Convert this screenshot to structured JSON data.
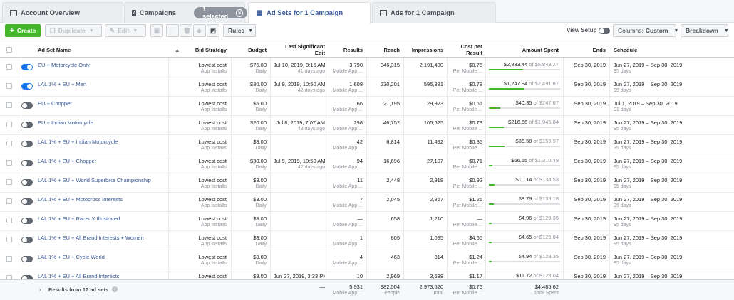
{
  "tabs": {
    "account": "Account Overview",
    "campaigns": "Campaigns",
    "selected": "1 selected",
    "adsets": "Ad Sets for 1 Campaign",
    "ads": "Ads for 1 Campaign"
  },
  "toolbar": {
    "create": "Create",
    "duplicate": "Duplicate",
    "edit": "Edit",
    "rules": "Rules",
    "view_setup": "View Setup",
    "columns_label": "Columns:",
    "columns_value": "Custom",
    "breakdown": "Breakdown"
  },
  "headers": {
    "name": "Ad Set Name",
    "bid": "Bid Strategy",
    "budget": "Budget",
    "last_edit": "Last Significant Edit",
    "results": "Results",
    "reach": "Reach",
    "impressions": "Impressions",
    "cpr": "Cost per Result",
    "spent": "Amount Spent",
    "ends": "Ends",
    "schedule": "Schedule"
  },
  "rows": [
    {
      "on": true,
      "name": "EU + Motorcycle Only",
      "bid": "Lowest cost",
      "bid_sub": "App Installs",
      "budget": "$75.00",
      "budget_sub": "Daily",
      "edit": "Jul 10, 2019, 8:15 AM",
      "edit_sub": "41 days ago",
      "results": "3,790",
      "results_sub": "Mobile App ...",
      "reach": "846,315",
      "impr": "2,191,400",
      "cpr": "$0.75",
      "cpr_sub": "Per Mobile ...",
      "spent": "$2,833.44",
      "of": "of $5,843.27",
      "pct": 0.48,
      "ends": "Sep 30, 2019",
      "sched": "Jun 27, 2019 – Sep 30, 2019",
      "days": "95 days"
    },
    {
      "on": true,
      "name": "LAL 1% + EU + Men",
      "bid": "Lowest cost",
      "bid_sub": "App Installs",
      "budget": "$30.00",
      "budget_sub": "Daily",
      "edit": "Jul 9, 2019, 10:50 AM",
      "edit_sub": "42 days ago",
      "results": "1,608",
      "results_sub": "Mobile App ...",
      "reach": "230,201",
      "impr": "595,381",
      "cpr": "$0.78",
      "cpr_sub": "Per Mobile ...",
      "spent": "$1,247.94",
      "of": "of $2,491.87",
      "pct": 0.5,
      "ends": "Sep 30, 2019",
      "sched": "Jun 27, 2019 – Sep 30, 2019",
      "days": "95 days"
    },
    {
      "on": false,
      "name": "EU + Chopper",
      "bid": "Lowest cost",
      "bid_sub": "App Installs",
      "budget": "$5.00",
      "budget_sub": "Daily",
      "edit": "",
      "edit_sub": "",
      "results": "66",
      "results_sub": "Mobile App ...",
      "reach": "21,195",
      "impr": "29,923",
      "cpr": "$0.61",
      "cpr_sub": "Per Mobile ...",
      "spent": "$40.35",
      "of": "of $247.67",
      "pct": 0.16,
      "ends": "Sep 30, 2019",
      "sched": "Jul 1, 2019 – Sep 30, 2019",
      "days": "91 days"
    },
    {
      "on": false,
      "name": "EU + Indian Motorcycle",
      "bid": "Lowest cost",
      "bid_sub": "App Installs",
      "budget": "$20.00",
      "budget_sub": "Daily",
      "edit": "Jul 8, 2019, 7:07 AM",
      "edit_sub": "43 days ago",
      "results": "298",
      "results_sub": "Mobile App ...",
      "reach": "46,752",
      "impr": "105,625",
      "cpr": "$0.73",
      "cpr_sub": "Per Mobile ...",
      "spent": "$216.56",
      "of": "of $1,045.84",
      "pct": 0.21,
      "ends": "Sep 30, 2019",
      "sched": "Jun 27, 2019 – Sep 30, 2019",
      "days": "95 days"
    },
    {
      "on": false,
      "name": "LAL 1% + EU + Indian Motorcycle",
      "bid": "Lowest cost",
      "bid_sub": "App Installs",
      "budget": "$3.00",
      "budget_sub": "Daily",
      "edit": "",
      "edit_sub": "",
      "results": "42",
      "results_sub": "Mobile App ...",
      "reach": "6,814",
      "impr": "11,492",
      "cpr": "$0.85",
      "cpr_sub": "Per Mobile ...",
      "spent": "$35.58",
      "of": "of $159.97",
      "pct": 0.22,
      "ends": "Sep 30, 2019",
      "sched": "Jun 27, 2019 – Sep 30, 2019",
      "days": "95 days"
    },
    {
      "on": false,
      "name": "LAL 1% + EU + Chopper",
      "bid": "Lowest cost",
      "bid_sub": "App Installs",
      "budget": "$30.00",
      "budget_sub": "Daily",
      "edit": "Jul 9, 2019, 10:50 AM",
      "edit_sub": "42 days ago",
      "results": "94",
      "results_sub": "Mobile App ...",
      "reach": "16,696",
      "impr": "27,107",
      "cpr": "$0.71",
      "cpr_sub": "Per Mobile ...",
      "spent": "$66.55",
      "of": "of $1,310.48",
      "pct": 0.05,
      "ends": "Sep 30, 2019",
      "sched": "Jun 27, 2019 – Sep 30, 2019",
      "days": "95 days"
    },
    {
      "on": false,
      "name": "LAL 1% + EU + World Superbike Championship",
      "bid": "Lowest cost",
      "bid_sub": "App Installs",
      "budget": "$3.00",
      "budget_sub": "Daily",
      "edit": "",
      "edit_sub": "",
      "results": "11",
      "results_sub": "Mobile App ...",
      "reach": "2,448",
      "impr": "2,918",
      "cpr": "$0.92",
      "cpr_sub": "Per Mobile ...",
      "spent": "$10.14",
      "of": "of $134.53",
      "pct": 0.08,
      "ends": "Sep 30, 2019",
      "sched": "Jun 27, 2019 – Sep 30, 2019",
      "days": "95 days"
    },
    {
      "on": false,
      "name": "LAL 1% + EU + Motocross Interests",
      "bid": "Lowest cost",
      "bid_sub": "App Installs",
      "budget": "$3.00",
      "budget_sub": "Daily",
      "edit": "",
      "edit_sub": "",
      "results": "7",
      "results_sub": "Mobile App ...",
      "reach": "2,045",
      "impr": "2,867",
      "cpr": "$1.26",
      "cpr_sub": "Per Mobile ...",
      "spent": "$8.79",
      "of": "of $133.18",
      "pct": 0.07,
      "ends": "Sep 30, 2019",
      "sched": "Jun 27, 2019 – Sep 30, 2019",
      "days": "95 days"
    },
    {
      "on": false,
      "name": "LAL 1% + EU + Racer X Illustrated",
      "bid": "Lowest cost",
      "bid_sub": "App Installs",
      "budget": "$3.00",
      "budget_sub": "Daily",
      "edit": "",
      "edit_sub": "",
      "results": "—",
      "results_sub": "Mobile App ...",
      "reach": "658",
      "impr": "1,210",
      "cpr": "—",
      "cpr_sub": "Per Mobile ...",
      "spent": "$4.96",
      "of": "of $129.35",
      "pct": 0.04,
      "ends": "Sep 30, 2019",
      "sched": "Jun 27, 2019 – Sep 30, 2019",
      "days": "95 days"
    },
    {
      "on": false,
      "name": "LAL 1% + EU + All Brand Interests + Women",
      "bid": "Lowest cost",
      "bid_sub": "App Installs",
      "budget": "$3.00",
      "budget_sub": "Daily",
      "edit": "",
      "edit_sub": "",
      "results": "1",
      "results_sub": "Mobile App ...",
      "reach": "805",
      "impr": "1,095",
      "cpr": "$4.65",
      "cpr_sub": "Per Mobile ...",
      "spent": "$4.65",
      "of": "of $129.04",
      "pct": 0.04,
      "ends": "Sep 30, 2019",
      "sched": "Jun 27, 2019 – Sep 30, 2019",
      "days": "95 days"
    },
    {
      "on": false,
      "name": "LAL 1% + EU + Cycle World",
      "bid": "Lowest cost",
      "bid_sub": "App Installs",
      "budget": "$3.00",
      "budget_sub": "Daily",
      "edit": "",
      "edit_sub": "",
      "results": "4",
      "results_sub": "Mobile App ...",
      "reach": "463",
      "impr": "814",
      "cpr": "$1.24",
      "cpr_sub": "Per Mobile ...",
      "spent": "$4.94",
      "of": "of $129.35",
      "pct": 0.04,
      "ends": "Sep 30, 2019",
      "sched": "Jun 27, 2019 – Sep 30, 2019",
      "days": "95 days"
    },
    {
      "on": false,
      "name": "LAL 1% + EU + All Brand Interests",
      "bid": "Lowest cost",
      "bid_sub": "",
      "budget": "$3.00",
      "budget_sub": "",
      "edit": "Jun 27, 2019, 3:33 PM",
      "edit_sub": "",
      "results": "10",
      "results_sub": "",
      "reach": "2,969",
      "impr": "3,688",
      "cpr": "$1.17",
      "cpr_sub": "",
      "spent": "$11.72",
      "of": "of $129.04",
      "pct": 0.09,
      "ends": "Sep 30, 2019",
      "sched": "Jun 27, 2019 – Sep 30, 2019",
      "days": ""
    }
  ],
  "footer": {
    "label": "Results from 12 ad sets",
    "edit": "—",
    "results": "5,931",
    "results_sub": "Mobile App ...",
    "reach": "982,504",
    "reach_sub": "People",
    "impr": "2,973,520",
    "impr_sub": "Total",
    "cpr": "$0.76",
    "cpr_sub": "Per Mobile ...",
    "spent": "$4,485.62",
    "spent_sub": "Total Spent"
  },
  "colors": {
    "accent": "#1877f2",
    "link": "#385898",
    "green": "#42b72a"
  }
}
